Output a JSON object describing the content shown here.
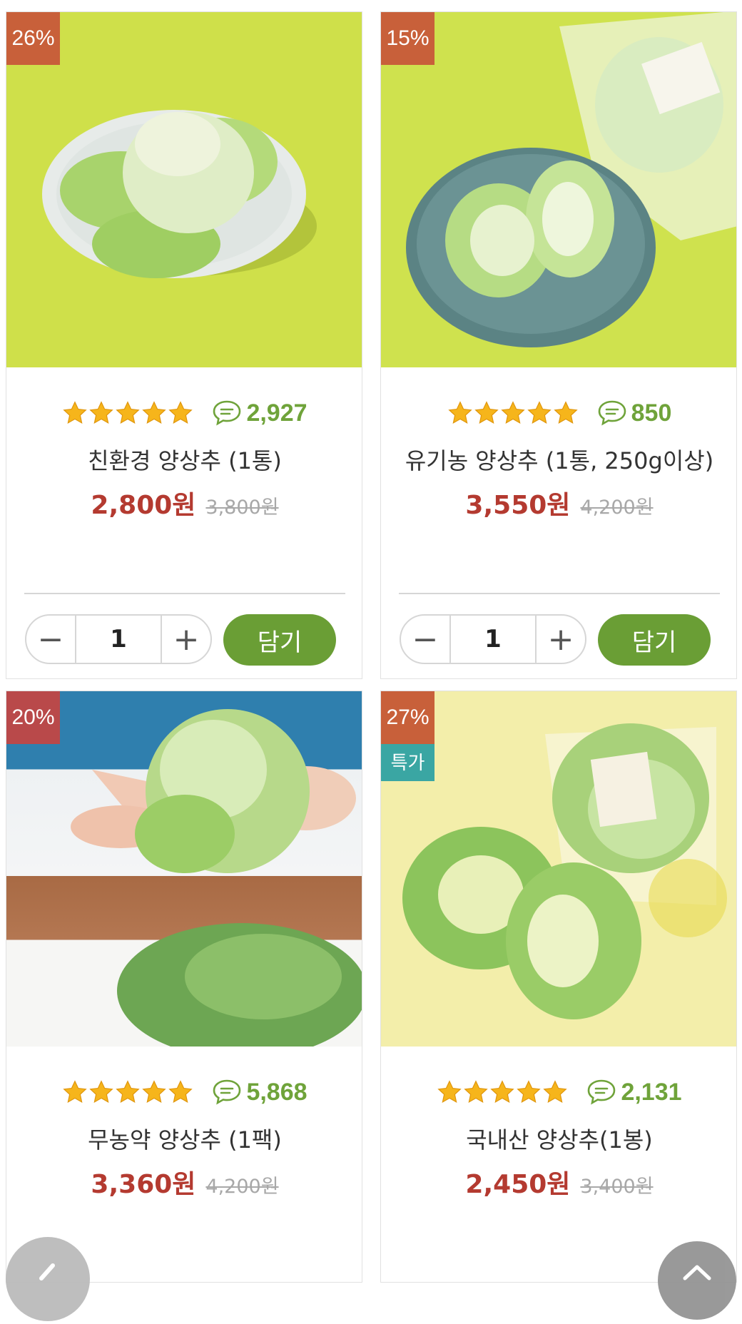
{
  "products": [
    {
      "discount": "26%",
      "special": "",
      "rating": 5,
      "reviews": "2,927",
      "name": "친환경 양상추 (1통)",
      "price": "2,800원",
      "original_price": "3,800원",
      "quantity": "1",
      "add_label": "담기"
    },
    {
      "discount": "15%",
      "special": "",
      "rating": 5,
      "reviews": "850",
      "name": "유기농 양상추 (1통, 250g이상)",
      "price": "3,550원",
      "original_price": "4,200원",
      "quantity": "1",
      "add_label": "담기"
    },
    {
      "discount": "20%",
      "special": "",
      "rating": 5,
      "reviews": "5,868",
      "name": "무농약 양상추 (1팩)",
      "price": "3,360원",
      "original_price": "4,200원"
    },
    {
      "discount": "27%",
      "special": "특가",
      "rating": 5,
      "reviews": "2,131",
      "name": "국내산 양상추(1봉)",
      "price": "2,450원",
      "original_price": "3,400원"
    }
  ],
  "controls": {
    "minus": "−",
    "plus": "+"
  },
  "colors": {
    "price": "#b43a30",
    "accent_green": "#6a9e35",
    "review_green": "#6fa33a",
    "discount_badge": "#c8603a",
    "special_badge": "#3aa6a3"
  },
  "icons": [
    "star-icon",
    "comment-icon",
    "minus-icon",
    "plus-icon"
  ]
}
